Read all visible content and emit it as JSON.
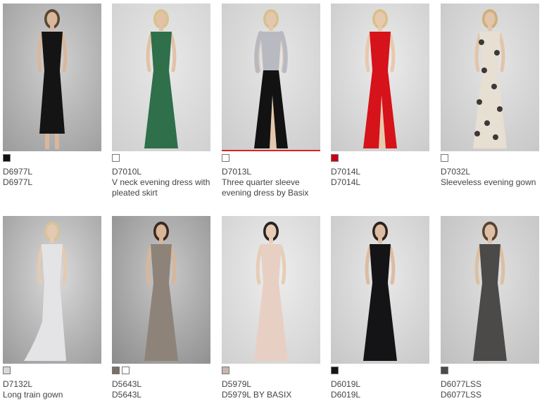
{
  "products": [
    {
      "code": "D6977L",
      "desc": "D6977L",
      "swatches": [
        "#111111"
      ],
      "dress": "#141414",
      "hair": "#5a4632",
      "skin": "#d9b79c",
      "bg": [
        "#9c9c9c",
        "#d0d0d0"
      ],
      "type": "short"
    },
    {
      "code": "D7010L",
      "desc": "V neck evening dress with pleated skirt",
      "swatches": [
        "#ffffff"
      ],
      "dress": "#2f6f4a",
      "hair": "#d9c28a",
      "skin": "#e2c2a6",
      "bg": [
        "#cfcfcf",
        "#e8e8e8"
      ],
      "type": "gown"
    },
    {
      "code": "D7013L",
      "desc": "Three quarter sleeve evening dress by Basix",
      "swatches": [
        "#ffffff"
      ],
      "dress": "#121212",
      "top": "#b9b9c2",
      "hair": "#d7c08c",
      "skin": "#e4c8ad",
      "bg": [
        "#cbcbcb",
        "#e6e6e6"
      ],
      "type": "slit",
      "selected": true
    },
    {
      "code": "D7014L",
      "desc": "D7014L",
      "swatches": [
        "#cc0011"
      ],
      "dress": "#d6121a",
      "hair": "#d8c088",
      "skin": "#e7c9ae",
      "bg": [
        "#c9c9c9",
        "#ebebeb"
      ],
      "type": "slit"
    },
    {
      "code": "D7032L",
      "desc": "Sleeveless evening gown",
      "swatches": [
        "#ffffff"
      ],
      "dress": "#e6dfd2",
      "hair": "#cdb07a",
      "skin": "#e2c5aa",
      "bg": [
        "#c6c6c6",
        "#e4e4e4"
      ],
      "type": "lace"
    },
    {
      "code": "D7132L",
      "desc": "Long train gown",
      "swatches": [
        "#d8d8d8"
      ],
      "dress": "#e4e4e6",
      "hair": "#d7c39a",
      "skin": "#e3cab1",
      "bg": [
        "#9a9a9a",
        "#dadada"
      ],
      "type": "train"
    },
    {
      "code": "D5643L",
      "desc": "D5643L",
      "swatches": [
        "#7a6f68",
        "#ffffff"
      ],
      "dress": "#8e8378",
      "hair": "#3b2a1f",
      "skin": "#d8b69a",
      "bg": [
        "#8d8d8d",
        "#c8c8c8"
      ],
      "type": "gown"
    },
    {
      "code": "D5979L",
      "desc": "D5979L BY BASIX",
      "swatches": [
        "#c9b6ad"
      ],
      "dress": "#e8cfc4",
      "hair": "#2a2220",
      "skin": "#e7cdb6",
      "bg": [
        "#d0d0d0",
        "#ededed"
      ],
      "type": "gown"
    },
    {
      "code": "D6019L",
      "desc": "D6019L",
      "swatches": [
        "#151515"
      ],
      "dress": "#141416",
      "hair": "#2e221c",
      "skin": "#dcbca2",
      "bg": [
        "#c7c7c7",
        "#e8e8e8"
      ],
      "type": "gown"
    },
    {
      "code": "D6077LSS",
      "desc": "D6077LSS",
      "swatches": [
        "#4a4a4a"
      ],
      "dress": "#4c4a48",
      "hair": "#5a4330",
      "skin": "#ddbfa4",
      "bg": [
        "#bfbfbf",
        "#dfdfdf"
      ],
      "type": "gown"
    }
  ]
}
